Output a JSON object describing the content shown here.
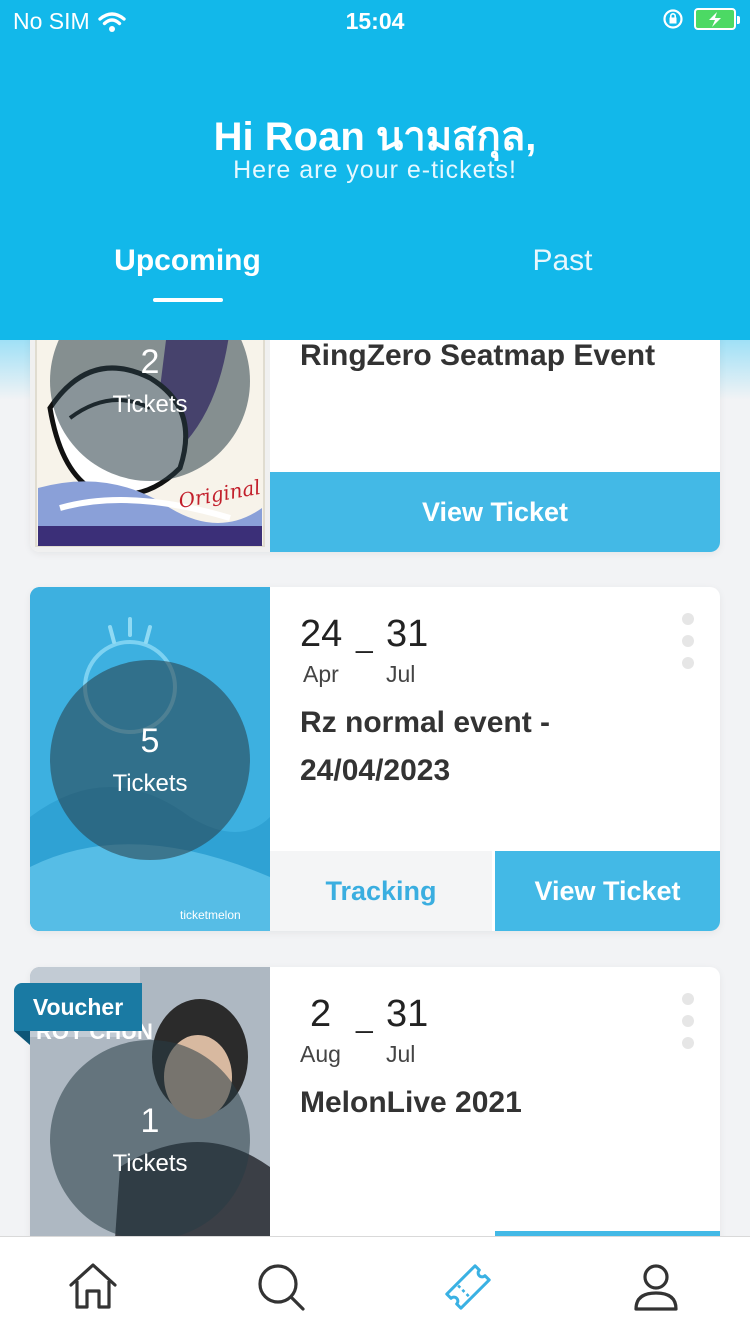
{
  "status_bar": {
    "carrier": "No SIM",
    "time": "15:04"
  },
  "header": {
    "greeting": "Hi Roan นามสกุล,",
    "subtitle": "Here are your e-tickets!",
    "tabs": [
      {
        "label": "Upcoming",
        "active": true
      },
      {
        "label": "Past",
        "active": false
      }
    ]
  },
  "cards": [
    {
      "title": "RingZero Seatmap Event",
      "ticket_count": "2",
      "tickets_label": "Tickets",
      "view_label": "View Ticket"
    },
    {
      "start_day": "24",
      "start_month": "Apr",
      "end_day": "31",
      "end_month": "Jul",
      "title": "Rz normal event - 24/04/2023",
      "ticket_count": "5",
      "tickets_label": "Tickets",
      "tracking_label": "Tracking",
      "view_label": "View Ticket",
      "brand": "ticketmelon"
    },
    {
      "start_day": "2",
      "start_month": "Aug",
      "end_day": "31",
      "end_month": "Jul",
      "title": "MelonLive 2021",
      "ticket_count": "1",
      "tickets_label": "Tickets",
      "badge": "Voucher",
      "poster_text": "ROY CHUN"
    }
  ],
  "nav": [
    "home-icon",
    "search-icon",
    "ticket-icon",
    "profile-icon"
  ],
  "colors": {
    "primary": "#12b8ea",
    "button": "#43b9e6",
    "tracking": "#3aaee0"
  }
}
